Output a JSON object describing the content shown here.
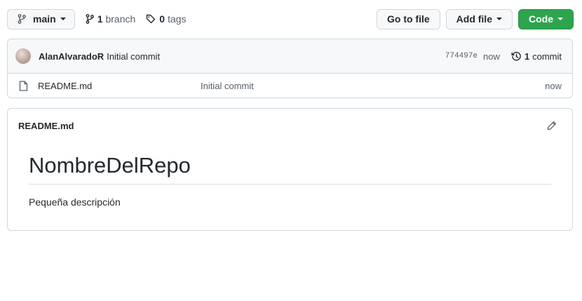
{
  "toolbar": {
    "branch_name": "main",
    "branches_count": "1",
    "branches_label": "branch",
    "tags_count": "0",
    "tags_label": "tags",
    "go_to_file": "Go to file",
    "add_file": "Add file",
    "code": "Code",
    "code_color": "#2da44e"
  },
  "latest_commit": {
    "author": "AlanAlvaradoR",
    "message": "Initial commit",
    "sha": "774497e",
    "age": "now",
    "commit_count": "1",
    "commit_label": "commit"
  },
  "files": [
    {
      "name": "README.md",
      "icon": "file-icon",
      "message": "Initial commit",
      "age": "now"
    }
  ],
  "readme": {
    "filename": "README.md",
    "heading": "NombreDelRepo",
    "description": "Pequeña descripción",
    "edit_icon": "pencil-icon"
  }
}
